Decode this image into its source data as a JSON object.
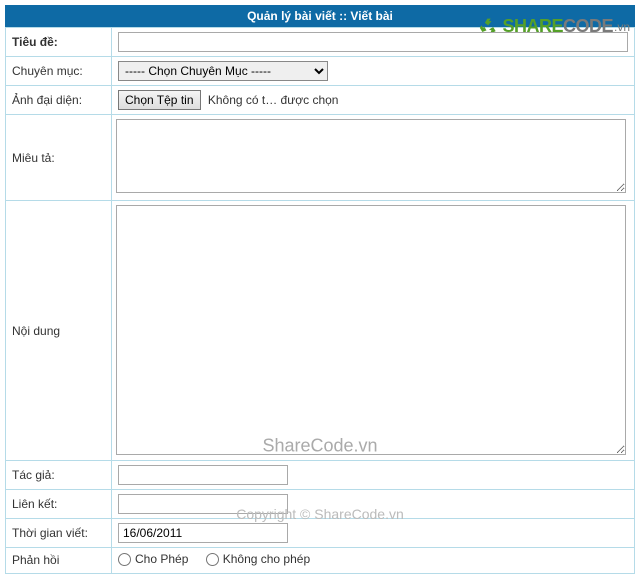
{
  "header": {
    "title": "Quản lý bài viết :: Viết bài"
  },
  "form": {
    "title_label": "Tiêu đề:",
    "title_value": "",
    "category_label": "Chuyên mục:",
    "category_selected": "----- Chọn Chuyên Mục -----",
    "avatar_label": "Ảnh đại diện:",
    "file_button": "Chọn Tệp tin",
    "file_status": "Không có t… được chọn",
    "desc_label": "Miêu tả:",
    "desc_value": "",
    "content_label": "Nội dung",
    "content_value": "",
    "author_label": "Tác giả:",
    "author_value": "",
    "link_label": "Liên kết:",
    "link_value": "",
    "time_label": "Thời gian viết:",
    "time_value": "16/06/2011",
    "feedback_label": "Phản hồi",
    "feedback_allow": "Cho Phép",
    "feedback_deny": "Không cho phép"
  },
  "watermark": {
    "brand_share": "SHARE",
    "brand_code": "CODE",
    "brand_suffix": ".vn",
    "center": "ShareCode.vn",
    "copy": "Copyright © ShareCode.vn"
  }
}
